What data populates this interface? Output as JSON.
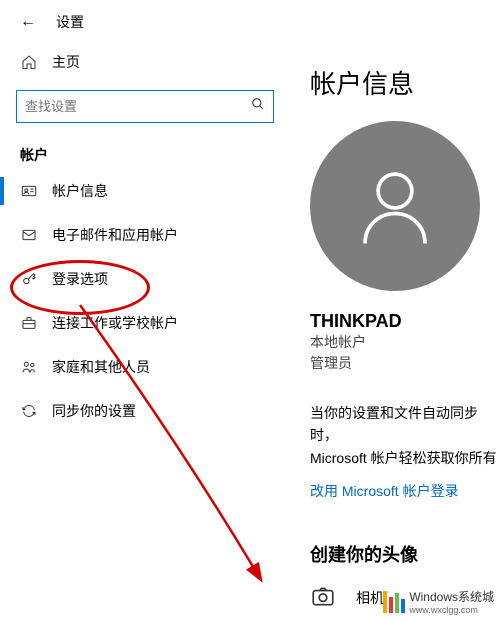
{
  "header": {
    "title": "设置"
  },
  "home": {
    "label": "主页"
  },
  "search": {
    "placeholder": "查找设置"
  },
  "sidebar": {
    "section": "帐户",
    "items": [
      {
        "label": "帐户信息"
      },
      {
        "label": "电子邮件和应用帐户"
      },
      {
        "label": "登录选项"
      },
      {
        "label": "连接工作或学校帐户"
      },
      {
        "label": "家庭和其他人员"
      },
      {
        "label": "同步你的设置"
      }
    ]
  },
  "main": {
    "title": "帐户信息",
    "username": "THINKPAD",
    "accountType": "本地帐户",
    "role": "管理员",
    "syncText1": "当你的设置和文件自动同步时，",
    "syncText2": "Microsoft 帐户轻松获取你所有",
    "link": "改用 Microsoft 帐户登录",
    "avatarTitle": "创建你的头像",
    "cameraLabel": "相机"
  },
  "watermark": {
    "text": "Windows系统城",
    "url": "www.wxclgg.com"
  }
}
